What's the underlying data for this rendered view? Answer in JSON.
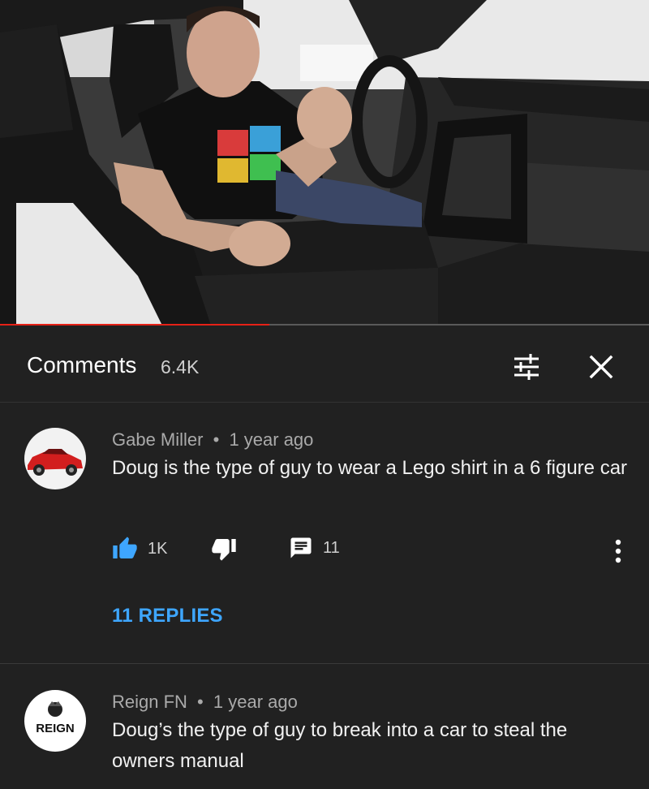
{
  "video": {
    "progress_fraction": 0.415,
    "progress_color": "#e62117"
  },
  "header": {
    "title": "Comments",
    "count": "6.4K",
    "sort_icon": "sort-filter-icon",
    "close_icon": "close-icon"
  },
  "comments": [
    {
      "author": "Gabe Miller",
      "separator": "•",
      "time": "1 year ago",
      "text": "Doug is the type of guy to wear a Lego shirt in a 6 figure car",
      "likes": "1K",
      "replies_count": "11",
      "replies_label": "11 REPLIES",
      "avatar_icon": "red-car-avatar"
    },
    {
      "author": "Reign FN",
      "separator": "•",
      "time": "1 year ago",
      "text": "Doug’s the type of guy to break into a car to steal the owners manual",
      "avatar_text": "REIGN",
      "avatar_icon": "reign-logo-avatar"
    }
  ],
  "colors": {
    "background": "#212121",
    "link": "#3ea6ff",
    "like_active": "#3ea6ff",
    "secondary_text": "#aaaaaa"
  }
}
